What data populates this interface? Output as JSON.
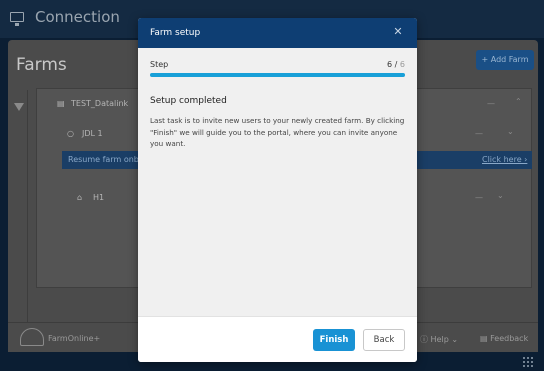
{
  "app": {
    "title": "Connection",
    "panel_title": "Farms",
    "add_farm_label": "+ Add Farm",
    "tree": {
      "datalink": "TEST_Datalink",
      "farm": "JDL 1",
      "resume_text": "Resume farm onboarding",
      "resume_link": "Click here ›",
      "house": "H1",
      "dash": "—",
      "chevron": "⌄"
    },
    "bottom": {
      "logo_text": "FarmOnline+",
      "help": "Help",
      "feedback": "Feedback"
    }
  },
  "modal": {
    "title": "Farm setup",
    "close": "✕",
    "step_label": "Step",
    "step_current": "6",
    "step_separator": " / ",
    "step_total": "6",
    "progress": 1.0,
    "heading": "Setup completed",
    "body": "Last task is to invite new users to your newly created farm. By clicking \"Finish\" we will guide you to the portal, where you can invite anyone you want.",
    "finish_label": "Finish",
    "back_label": "Back"
  },
  "colors": {
    "header": "#0e3e73",
    "progress": "#18a0d8",
    "finish": "#1992d4"
  }
}
